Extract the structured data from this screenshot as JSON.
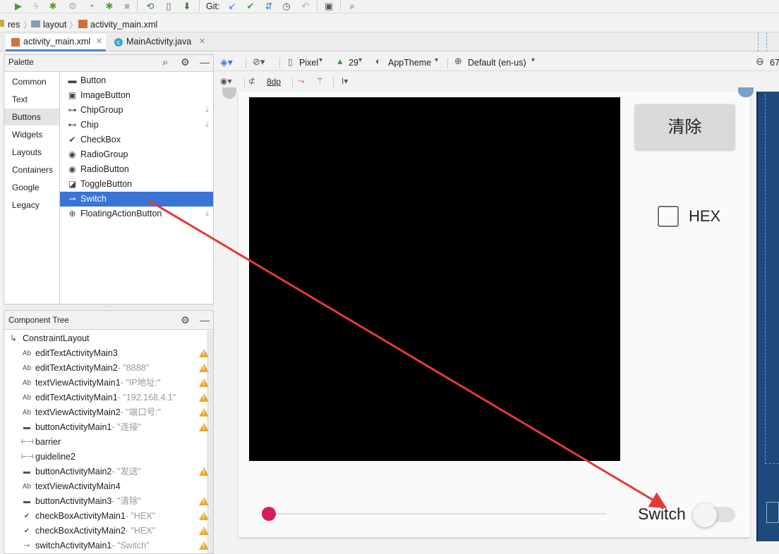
{
  "toolbar": {
    "git_label": "Git:"
  },
  "breadcrumb": {
    "items": [
      "res",
      "layout",
      "activity_main.xml"
    ]
  },
  "tabs": [
    {
      "label": "activity_main.xml",
      "active": true
    },
    {
      "label": "MainActivity.java",
      "active": false
    }
  ],
  "palette": {
    "title": "Palette",
    "categories": [
      "Common",
      "Text",
      "Buttons",
      "Widgets",
      "Layouts",
      "Containers",
      "Google",
      "Legacy"
    ],
    "selected_category": "Buttons",
    "items": [
      {
        "label": "Button",
        "icon": "button-icon"
      },
      {
        "label": "ImageButton",
        "icon": "image-button-icon"
      },
      {
        "label": "ChipGroup",
        "icon": "chip-group-icon",
        "download": true
      },
      {
        "label": "Chip",
        "icon": "chip-icon",
        "download": true
      },
      {
        "label": "CheckBox",
        "icon": "checkbox-icon"
      },
      {
        "label": "RadioGroup",
        "icon": "radio-group-icon"
      },
      {
        "label": "RadioButton",
        "icon": "radio-button-icon"
      },
      {
        "label": "ToggleButton",
        "icon": "toggle-button-icon"
      },
      {
        "label": "Switch",
        "icon": "switch-icon",
        "selected": true
      },
      {
        "label": "FloatingActionButton",
        "icon": "fab-icon",
        "download": true
      }
    ]
  },
  "component_tree": {
    "title": "Component Tree",
    "root": "ConstraintLayout",
    "rows": [
      {
        "icon": "Ab",
        "name": "editTextActivityMain3",
        "sub": "",
        "warn": true
      },
      {
        "icon": "Ab",
        "name": "editTextActivityMain2",
        "sub": "- \"8888\"",
        "warn": true
      },
      {
        "icon": "Ab",
        "name": "textViewActivityMain1",
        "sub": "- \"IP地址:\"",
        "warn": true
      },
      {
        "icon": "Ab",
        "name": "editTextActivityMain1",
        "sub": "- \"192.168.4.1\"",
        "warn": true
      },
      {
        "icon": "Ab",
        "name": "textViewActivityMain2",
        "sub": "- \"端口号:\"",
        "warn": true
      },
      {
        "icon": "btn",
        "name": "buttonActivityMain1",
        "sub": "- \"连接\"",
        "warn": true
      },
      {
        "icon": "bar",
        "name": "barrier",
        "sub": "",
        "warn": false
      },
      {
        "icon": "guide",
        "name": "guideline2",
        "sub": "",
        "warn": false
      },
      {
        "icon": "btn",
        "name": "buttonActivityMain2",
        "sub": "- \"发送\"",
        "warn": true
      },
      {
        "icon": "Ab",
        "name": "textViewActivityMain4",
        "sub": "",
        "warn": false
      },
      {
        "icon": "btn",
        "name": "buttonActivityMain3",
        "sub": "- \"清除\"",
        "warn": true
      },
      {
        "icon": "check",
        "name": "checkBoxActivityMain1",
        "sub": "- \"HEX\"",
        "warn": true
      },
      {
        "icon": "check",
        "name": "checkBoxActivityMain2",
        "sub": "- \"HEX\"",
        "warn": true
      },
      {
        "icon": "switch",
        "name": "switchActivityMain1",
        "sub": "- \"Switch\"",
        "warn": true
      }
    ]
  },
  "design_toolbar": {
    "device": "Pixel",
    "api": "29",
    "theme": "AppTheme",
    "locale": "Default (en-us)",
    "zoom": "67",
    "margin": "8dp"
  },
  "preview": {
    "clear_button": "清除",
    "hex_label": "HEX",
    "switch_label": "Switch"
  },
  "colors": {
    "selection": "#3875d6",
    "accent": "#d81b60",
    "arrow": "#e53935",
    "warning": "#e8a93a"
  }
}
